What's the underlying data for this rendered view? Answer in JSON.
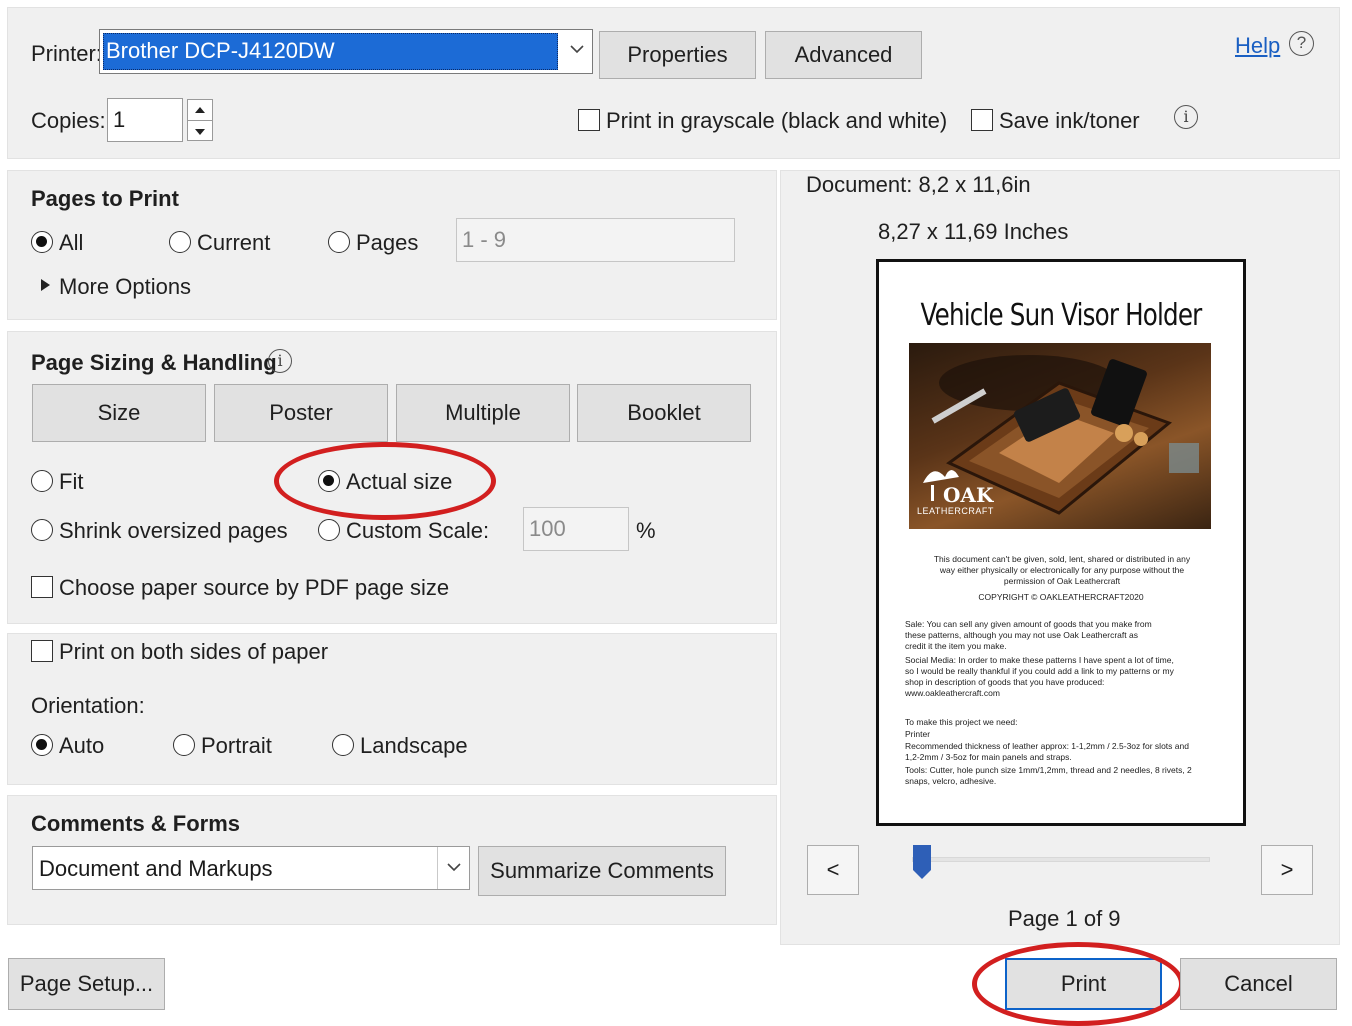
{
  "top": {
    "printer_label": "Printer:",
    "printer_value": "Brother DCP-J4120DW",
    "properties_label": "Properties",
    "advanced_label": "Advanced",
    "help_label": "Help",
    "copies_label": "Copies:",
    "copies_value": "1",
    "grayscale_label": "Print in grayscale (black and white)",
    "save_ink_label": "Save ink/toner"
  },
  "pages_to_print": {
    "title": "Pages to Print",
    "all_label": "All",
    "current_label": "Current",
    "pages_label": "Pages",
    "pages_range": "1 - 9",
    "more_options_label": "More Options",
    "selected": "All"
  },
  "sizing": {
    "title": "Page Sizing & Handling",
    "tabs": [
      "Size",
      "Poster",
      "Multiple",
      "Booklet"
    ],
    "fit_label": "Fit",
    "actual_size_label": "Actual size",
    "shrink_label": "Shrink oversized pages",
    "custom_scale_label": "Custom Scale:",
    "custom_scale_value": "100",
    "percent_label": "%",
    "paper_source_label": "Choose paper source by PDF page size",
    "selected": "Actual size"
  },
  "orientation": {
    "both_sides_label": "Print on both sides of paper",
    "title": "Orientation:",
    "auto_label": "Auto",
    "portrait_label": "Portrait",
    "landscape_label": "Landscape",
    "selected": "Auto"
  },
  "comments": {
    "title": "Comments & Forms",
    "select_value": "Document and Markups",
    "summarize_label": "Summarize Comments"
  },
  "preview": {
    "document_label": "Document: 8,2 x 11,6in",
    "size_label": "8,27 x 11,69 Inches",
    "doc_title": "Vehicle Sun Visor Holder",
    "logo_text": "OAK",
    "logo_sub": "LEATHERCRAFT",
    "para1": "This document can't be given, sold, lent, shared or distributed in any way either physically or electronically for any purpose without the permission of Oak Leathercraft",
    "copyright": "COPYRIGHT © OAKLEATHERCRAFT2020",
    "para2": "Sale: You can sell any given amount of goods that you make from these patterns, although you may not use Oak Leathercraft as credit it the item you make.",
    "para3": "Social Media: In order to make these patterns I have spent a lot of time, so I would be really thankful if you could add a link to my patterns or my shop in description of goods that you have produced: www.oakleathercraft.com",
    "para4": "To make this project we need:",
    "para5": "Printer",
    "para6": "Recommended thickness of leather approx: 1-1,2mm / 2.5-3oz for slots and 1,2-2mm / 3-5oz for main panels and straps.",
    "para7": "Tools: Cutter, hole punch size 1mm/1,2mm, thread and 2 needles, 8 rivets, 2 snaps, velcro, adhesive.",
    "prev_label": "<",
    "next_label": ">",
    "page_label": "Page 1 of 9",
    "slider_fraction": 0.0
  },
  "footer": {
    "page_setup_label": "Page Setup...",
    "print_label": "Print",
    "cancel_label": "Cancel"
  },
  "colors": {
    "annotation_red": "#d21f1f",
    "selection_blue": "#1c6bd6",
    "link_blue": "#1a5fc2"
  }
}
